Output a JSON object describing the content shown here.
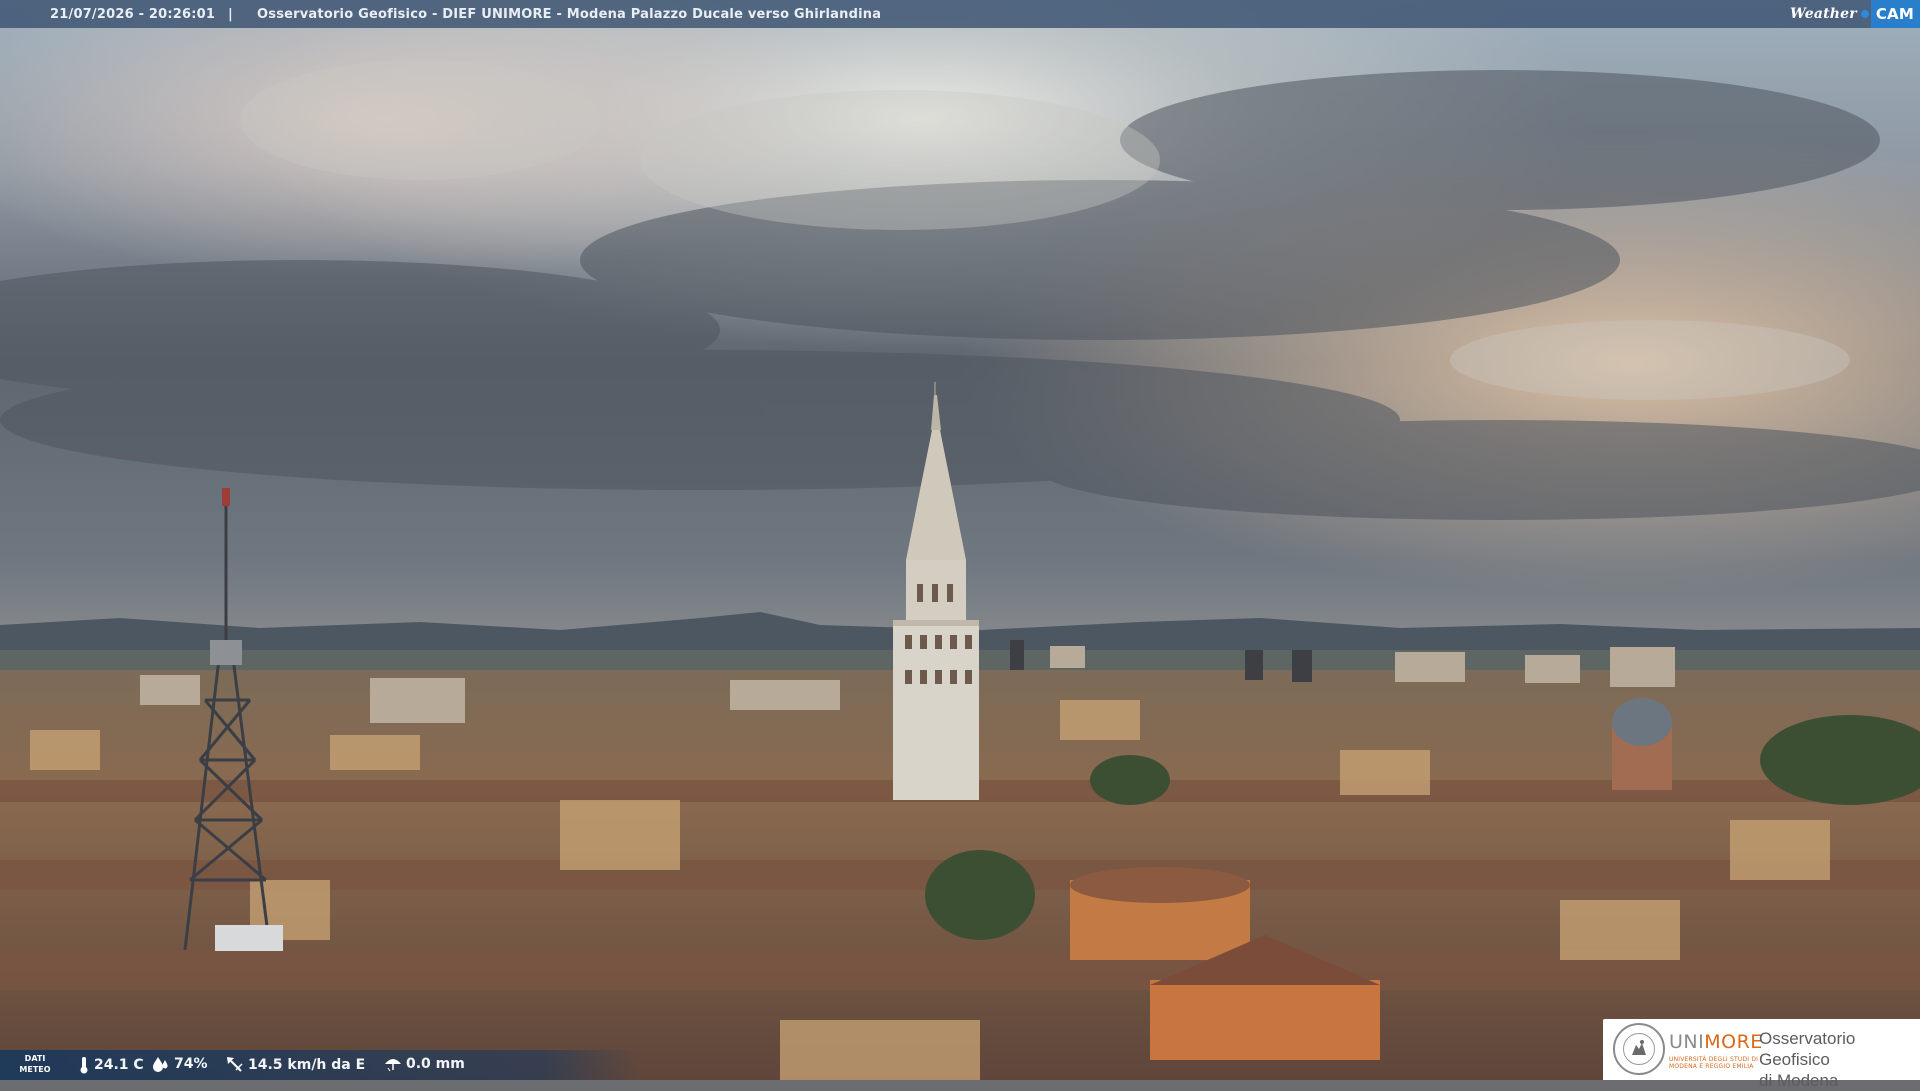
{
  "header": {
    "timestamp": "21/07/2026 - 20:26:01",
    "separator": "|",
    "title": "Osservatorio Geofisico - DIEF UNIMORE - Modena Palazzo Ducale verso Ghirlandina"
  },
  "brand": {
    "weather_text": "Weather",
    "cam_text": "CAM",
    "accent_color": "#2a7fcc"
  },
  "meteo": {
    "label_line1": "DATI",
    "label_line2": "METEO",
    "temperature": "24.1 C",
    "humidity": "74%",
    "wind": "14.5 km/h da E",
    "rain": "0.0 mm",
    "icons": [
      "thermometer-icon",
      "humidity-drop-icon",
      "wind-vane-icon",
      "rain-gauge-icon"
    ]
  },
  "logo": {
    "uni_prefix": "UNI",
    "uni_suffix": "MORE",
    "uni_subtitle": "UNIVERSITÀ DEGLI STUDI DI MODENA E REGGIO EMILIA",
    "observatory_line1": "Osservatorio Geofisico",
    "observatory_line2": "di Modena",
    "accent_color": "#d9691c"
  },
  "scene": {
    "description_subject": "webcam"
  }
}
